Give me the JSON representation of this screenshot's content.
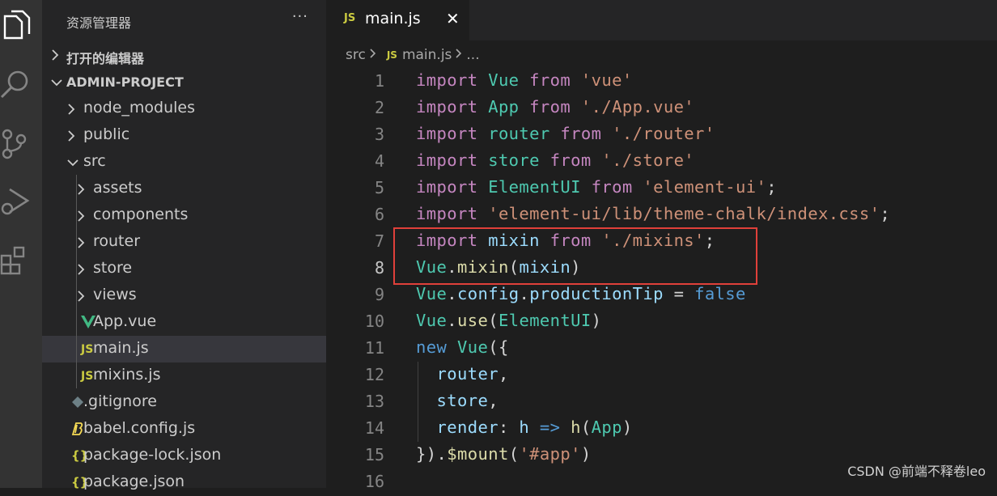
{
  "activity_bar": {
    "icons": [
      "files-icon",
      "search-icon",
      "source-control-icon",
      "run-debug-icon",
      "extensions-icon"
    ]
  },
  "sidebar": {
    "title": "资源管理器",
    "more": "···",
    "open_editors": "打开的编辑器",
    "project": "ADMIN-PROJECT",
    "tree": [
      {
        "label": "node_modules",
        "type": "folder"
      },
      {
        "label": "public",
        "type": "folder"
      },
      {
        "label": "src",
        "type": "folder-open"
      },
      {
        "label": "assets",
        "type": "folder"
      },
      {
        "label": "components",
        "type": "folder"
      },
      {
        "label": "router",
        "type": "folder"
      },
      {
        "label": "store",
        "type": "folder"
      },
      {
        "label": "views",
        "type": "folder"
      },
      {
        "label": "App.vue",
        "type": "vue"
      },
      {
        "label": "main.js",
        "type": "js",
        "active": true
      },
      {
        "label": "mixins.js",
        "type": "js"
      },
      {
        "label": ".gitignore",
        "type": "git"
      },
      {
        "label": "babel.config.js",
        "type": "babel"
      },
      {
        "label": "package-lock.json",
        "type": "json"
      },
      {
        "label": "package.json",
        "type": "json"
      }
    ],
    "icon_text": {
      "js": "JS",
      "json": "{}"
    }
  },
  "editor": {
    "tab": {
      "icon": "JS",
      "name": "main.js",
      "close": "✕"
    },
    "breadcrumb": {
      "folder": "src",
      "icon": "JS",
      "file": "main.js",
      "more": "..."
    },
    "line_numbers": [
      "1",
      "2",
      "3",
      "4",
      "5",
      "6",
      "7",
      "8",
      "9",
      "10",
      "11",
      "12",
      "13",
      "14",
      "15",
      "16"
    ],
    "current_line": 8,
    "colors": {
      "keyword": "#c586c0",
      "identifier": "#4ec9b0",
      "string": "#ce9178",
      "function": "#dcdcaa",
      "variable": "#9cdcfe",
      "plain": "#d4d4d4",
      "boolean": "#569cd6",
      "highlight": "#e0403a"
    },
    "code_lines": [
      [
        [
          "import ",
          "kw"
        ],
        [
          "Vue",
          "id"
        ],
        [
          " from ",
          "kw"
        ],
        [
          "'vue'",
          "str"
        ]
      ],
      [
        [
          "import ",
          "kw"
        ],
        [
          "App",
          "id"
        ],
        [
          " from ",
          "kw"
        ],
        [
          "'./App.vue'",
          "str"
        ]
      ],
      [
        [
          "import ",
          "kw"
        ],
        [
          "router",
          "id"
        ],
        [
          " from ",
          "kw"
        ],
        [
          "'./router'",
          "str"
        ]
      ],
      [
        [
          "import ",
          "kw"
        ],
        [
          "store",
          "id"
        ],
        [
          " from ",
          "kw"
        ],
        [
          "'./store'",
          "str"
        ]
      ],
      [
        [
          "import ",
          "kw"
        ],
        [
          "ElementUI",
          "id"
        ],
        [
          " from ",
          "kw"
        ],
        [
          "'element-ui'",
          "str"
        ],
        [
          ";",
          "pl"
        ]
      ],
      [
        [
          "import ",
          "kw"
        ],
        [
          "'element-ui/lib/theme-chalk/index.css'",
          "str"
        ],
        [
          ";",
          "pl"
        ]
      ],
      [
        [
          "import ",
          "kw"
        ],
        [
          "mixin",
          "var"
        ],
        [
          " from ",
          "kw"
        ],
        [
          "'./mixins'",
          "str"
        ],
        [
          ";",
          "pl"
        ]
      ],
      [
        [
          "Vue",
          "id"
        ],
        [
          ".",
          "pl"
        ],
        [
          "mixin",
          "fn"
        ],
        [
          "(",
          "pl"
        ],
        [
          "mixin",
          "var"
        ],
        [
          ")",
          "pl"
        ]
      ],
      [
        [
          "Vue",
          "id"
        ],
        [
          ".",
          "pl"
        ],
        [
          "config",
          "var"
        ],
        [
          ".",
          "pl"
        ],
        [
          "productionTip",
          "var"
        ],
        [
          " = ",
          "pl"
        ],
        [
          "false",
          "bool"
        ]
      ],
      [
        [
          "Vue",
          "id"
        ],
        [
          ".",
          "pl"
        ],
        [
          "use",
          "fn"
        ],
        [
          "(",
          "pl"
        ],
        [
          "ElementUI",
          "id"
        ],
        [
          ")",
          "pl"
        ]
      ],
      [
        [
          "new ",
          "bool"
        ],
        [
          "Vue",
          "id"
        ],
        [
          "({",
          "pl"
        ]
      ],
      [
        [
          "  ",
          "pl"
        ],
        [
          "router",
          "var"
        ],
        [
          ",",
          "pl"
        ]
      ],
      [
        [
          "  ",
          "pl"
        ],
        [
          "store",
          "var"
        ],
        [
          ",",
          "pl"
        ]
      ],
      [
        [
          "  ",
          "pl"
        ],
        [
          "render",
          "var"
        ],
        [
          ": ",
          "pl"
        ],
        [
          "h",
          "var"
        ],
        [
          " => ",
          "bool"
        ],
        [
          "h",
          "fn"
        ],
        [
          "(",
          "pl"
        ],
        [
          "App",
          "id"
        ],
        [
          ")",
          "pl"
        ]
      ],
      [
        [
          "}).",
          "pl"
        ],
        [
          "$mount",
          "fn"
        ],
        [
          "(",
          "pl"
        ],
        [
          "'#app'",
          "str"
        ],
        [
          ")",
          "pl"
        ]
      ],
      []
    ]
  },
  "watermark": "CSDN @前端不释卷leo"
}
